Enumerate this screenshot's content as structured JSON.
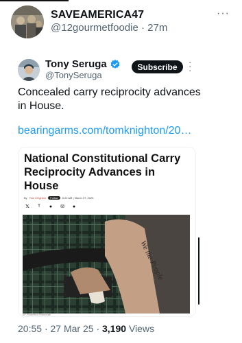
{
  "outer_post": {
    "display_name": "SAVEAMERICA47",
    "handle": "@12gourmetfoodie",
    "separator": "·",
    "age": "27m",
    "more_label": "···"
  },
  "quoted_post": {
    "display_name": "Tony Seruga",
    "handle": "@TonySeruga",
    "subscribe_label": "Subscribe",
    "text": "Concealed carry reciprocity advances in House.",
    "link": "bearingarms.com/tomknighton/20…",
    "verified_color": "#1d9bf0"
  },
  "article_preview": {
    "headline": "National Constitutional Carry Reciprocity Advances in House",
    "byline_prefix": "By",
    "author": "Tom Knighton",
    "follow_label": "Follow",
    "date": "6:20 AM | March 27, 2025",
    "share_icons": [
      "x-icon",
      "threads-icon",
      "reddit-icon",
      "email-icon",
      "comment-icon"
    ],
    "photo_caption": "AP Photo/Rich Pedroncelli",
    "tattoo_text": "We the People"
  },
  "footer": {
    "time": "20:55",
    "date": "27 Mar 25",
    "views_count": "3,190",
    "views_label": "Views"
  },
  "colors": {
    "link": "#1d9bf0",
    "secondary_text": "#536471",
    "primary_text": "#0f1419"
  }
}
